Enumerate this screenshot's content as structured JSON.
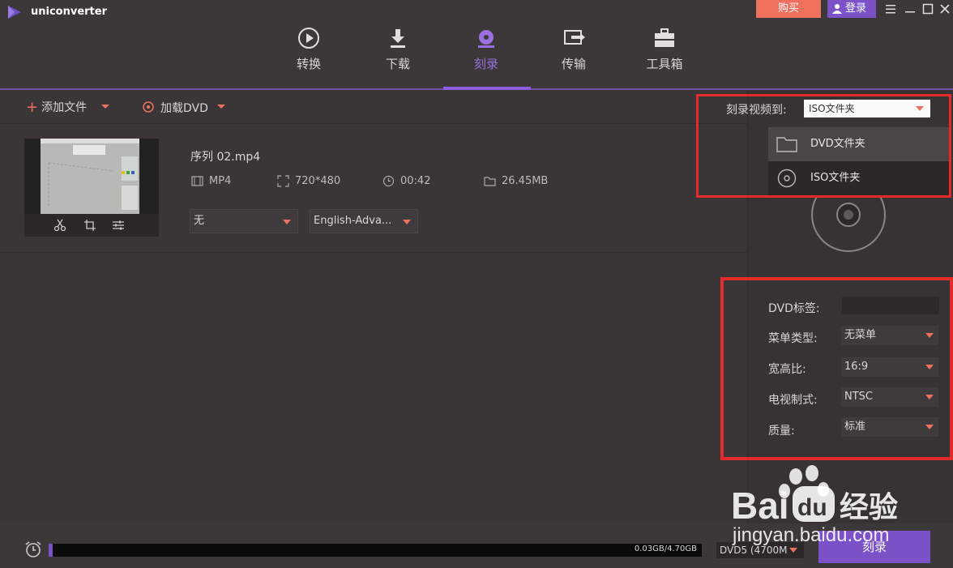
{
  "app": {
    "name": "uniconverter"
  },
  "header": {
    "buy_label": "购买",
    "login_label": "登录",
    "tabs": [
      {
        "label": "转换",
        "icon": "play-circle-icon"
      },
      {
        "label": "下载",
        "icon": "download-icon"
      },
      {
        "label": "刻录",
        "icon": "burn-disc-icon",
        "active": true
      },
      {
        "label": "传输",
        "icon": "transfer-icon"
      },
      {
        "label": "工具箱",
        "icon": "toolbox-icon"
      }
    ]
  },
  "toolbar": {
    "add_file_label": "添加文件",
    "load_dvd_label": "加载DVD"
  },
  "file": {
    "name": "序列 02.mp4",
    "format": "MP4",
    "resolution": "720*480",
    "duration": "00:42",
    "size": "26.45MB",
    "subtitle": "无",
    "audio": "English-Adva..."
  },
  "burn_panel": {
    "burn_to_label": "刻录视频到:",
    "burn_to_value": "ISO文件夹",
    "options": [
      {
        "label": "DVD文件夹",
        "icon": "folder-icon",
        "highlighted": true
      },
      {
        "label": "ISO文件夹",
        "icon": "disc-icon"
      }
    ]
  },
  "settings": {
    "dvd_label_label": "DVD标签:",
    "dvd_label_value": "",
    "menu_type_label": "菜单类型:",
    "menu_type_value": "无菜单",
    "aspect_label": "宽高比:",
    "aspect_value": "16:9",
    "tv_standard_label": "电视制式:",
    "tv_standard_value": "NTSC",
    "quality_label": "质量:",
    "quality_value": "标准"
  },
  "bottom": {
    "capacity_text": "0.03GB/4.70GB",
    "progress_fraction": 0.006,
    "dvd_type": "DVD5 (4700M",
    "burn_label": "刻录"
  },
  "watermark": {
    "brand": "Bai",
    "brand2": "du",
    "suffix": "经验",
    "url": "jingyan.baidu.com"
  },
  "colors": {
    "accent": "#7b52c8",
    "buy": "#f0705e",
    "highlight_box": "#e42b2b"
  }
}
